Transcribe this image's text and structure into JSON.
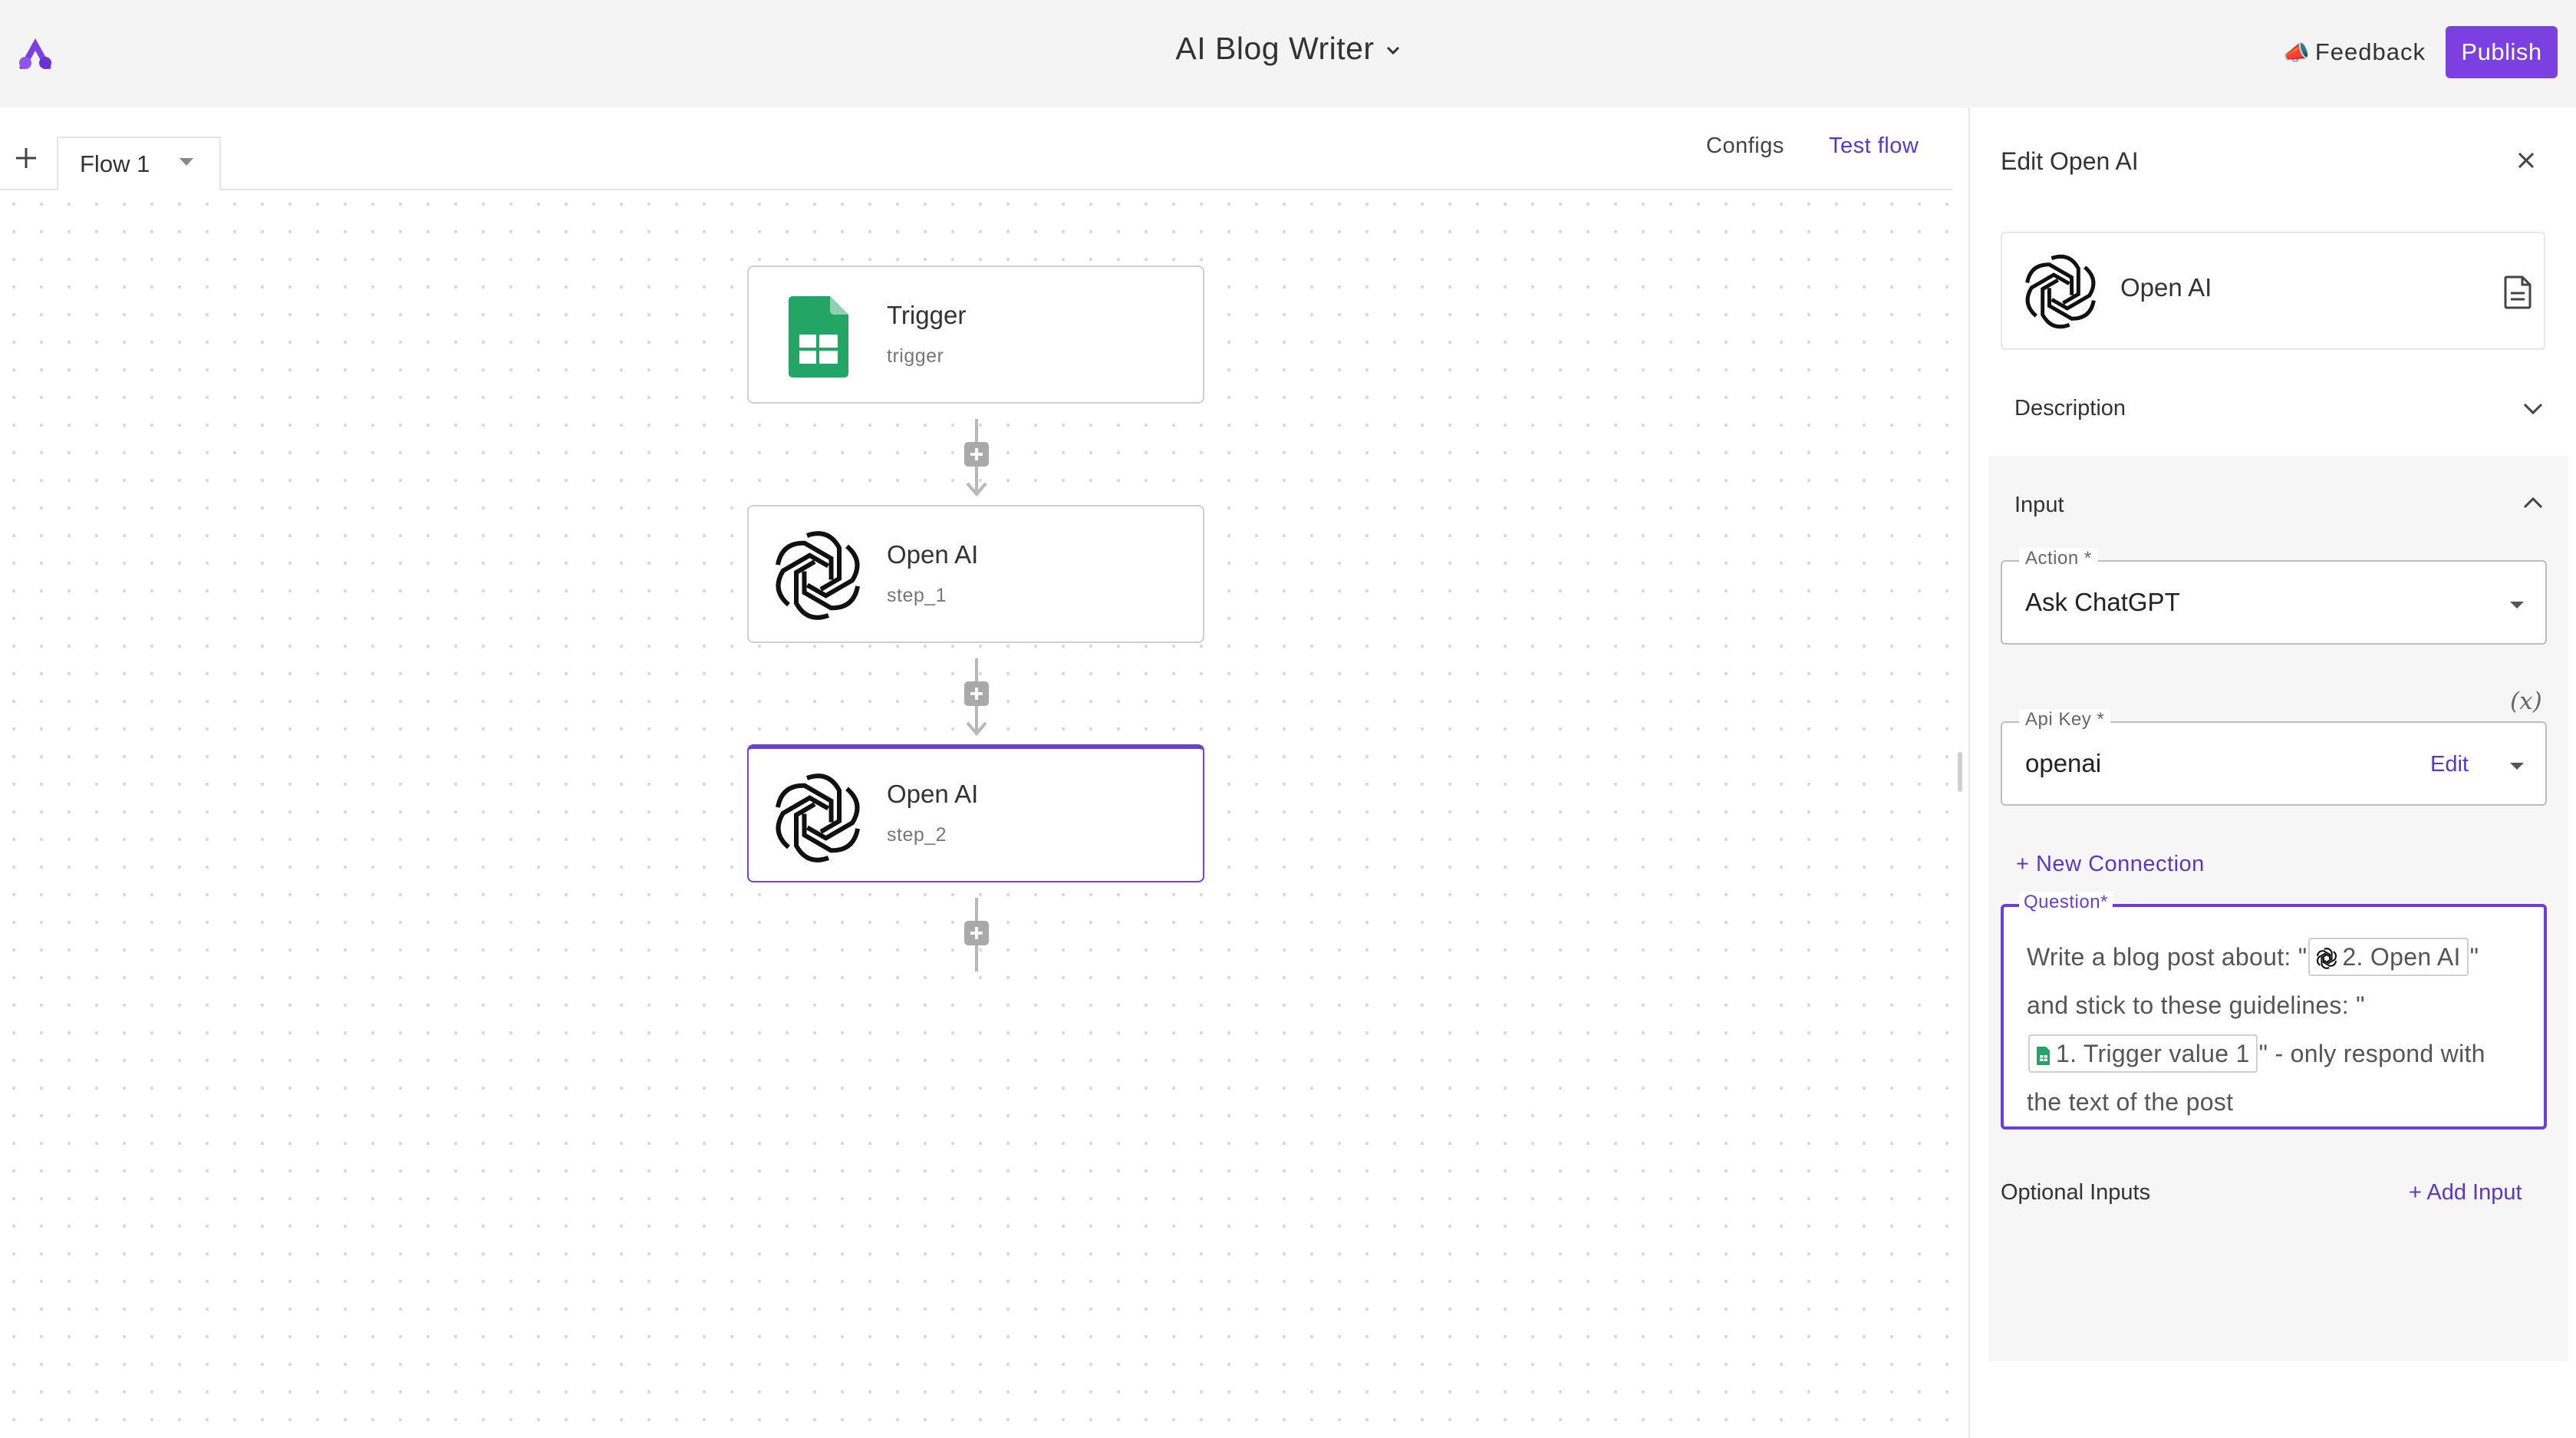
{
  "header": {
    "app_title": "AI Blog Writer",
    "feedback_label": "Feedback",
    "publish_label": "Publish",
    "accent_color": "#7c3fe0"
  },
  "tabbar": {
    "tabs": [
      {
        "label": "Flow 1"
      }
    ],
    "configs_label": "Configs",
    "test_flow_label": "Test flow"
  },
  "flow": {
    "nodes": [
      {
        "title": "Trigger",
        "subtitle": "trigger",
        "icon": "google-sheets-icon"
      },
      {
        "title": "Open AI",
        "subtitle": "step_1",
        "icon": "openai-icon"
      },
      {
        "title": "Open AI",
        "subtitle": "step_2",
        "icon": "openai-icon",
        "selected": true
      }
    ]
  },
  "panel": {
    "title": "Edit Open AI",
    "piece_name": "Open AI",
    "description_label": "Description",
    "input_label": "Input",
    "action": {
      "label": "Action *",
      "value": "Ask ChatGPT"
    },
    "api_key": {
      "label": "Api Key *",
      "value": "openai",
      "edit_label": "Edit"
    },
    "variable_button": "(x)",
    "new_connection_label": "+ New Connection",
    "question": {
      "label": "Question*",
      "text_1": "Write a blog post about: \"",
      "chip_1": "2. Open AI",
      "text_2": "\" and stick to these guidelines: \"",
      "chip_2": "1. Trigger value 1",
      "text_3": "\" - only respond with the text of the post"
    },
    "optional_inputs_label": "Optional Inputs",
    "add_input_label": "+ Add Input"
  }
}
